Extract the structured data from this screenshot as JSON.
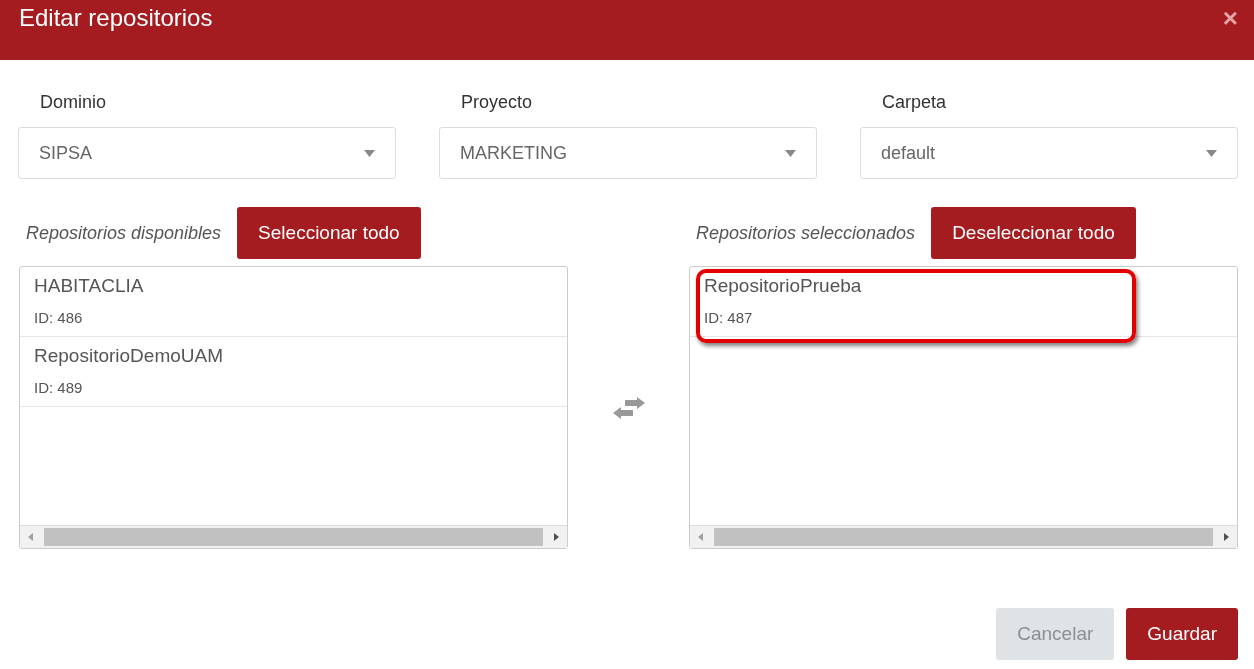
{
  "window": {
    "title": "Editar repositorios",
    "close": "×"
  },
  "filters": [
    {
      "label": "Dominio",
      "value": "SIPSA"
    },
    {
      "label": "Proyecto",
      "value": "MARKETING"
    },
    {
      "label": "Carpeta",
      "value": "default"
    }
  ],
  "available": {
    "title": "Repositorios disponibles",
    "button": "Seleccionar todo",
    "items": [
      {
        "name": "HABITACLIA",
        "id": "ID: 486",
        "highlighted": false
      },
      {
        "name": "RepositorioDemoUAM",
        "id": "ID: 489",
        "highlighted": false
      }
    ]
  },
  "selected": {
    "title": "Repositorios seleccionados",
    "button": "Deseleccionar todo",
    "items": [
      {
        "name": "RepositorioPrueba",
        "id": "ID: 487",
        "highlighted": true
      }
    ]
  },
  "buttons": [
    {
      "label": "Cancelar",
      "kind": "secondary"
    },
    {
      "label": "Guardar",
      "kind": "primary"
    }
  ]
}
